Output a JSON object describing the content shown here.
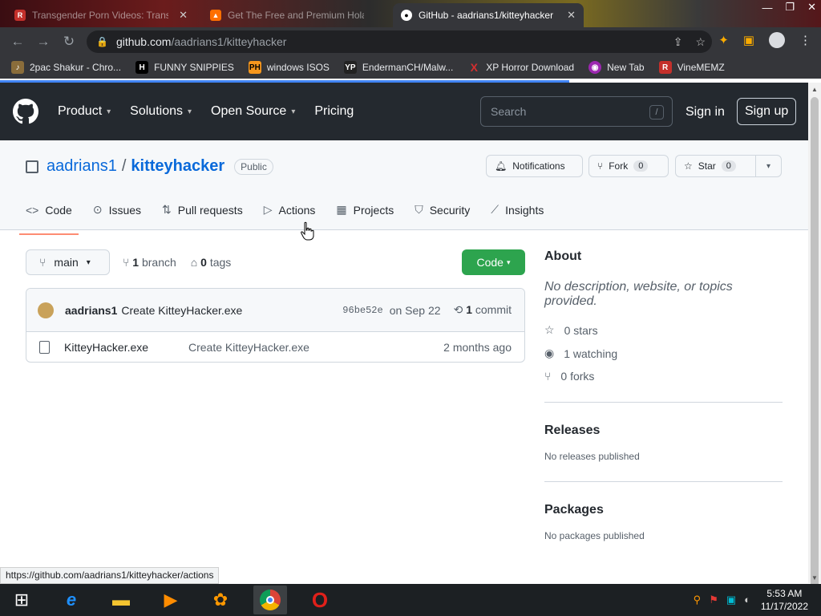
{
  "browser": {
    "tabs": [
      {
        "title": "Transgender Porn Videos: Trans...",
        "favicon": "R",
        "color": "#c4302b",
        "active": false
      },
      {
        "title": "Get The Free and Premium Hola ...",
        "favicon": "fire",
        "color": "#ff6f00",
        "active": false
      },
      {
        "title": "GitHub - aadrians1/kitteyhacker",
        "favicon": "github",
        "color": "#ffffff",
        "active": true
      }
    ],
    "url_host": "github.com",
    "url_path": "/aadrians1/kitteyhacker",
    "bookmarks": [
      {
        "label": "2pac Shakur - Chro...",
        "icon": "music-icon",
        "color": "#8a6d3b"
      },
      {
        "label": "FUNNY SNIPPIES",
        "icon": "H",
        "color": "#000000"
      },
      {
        "label": "windows ISOS",
        "icon": "PH",
        "color": "#f7971d"
      },
      {
        "label": "EndermanCH/Malw...",
        "icon": "YP",
        "color": "#222222"
      },
      {
        "label": "XP Horror Download",
        "icon": "X",
        "color": "#d32f2f"
      },
      {
        "label": "New Tab",
        "icon": "globe-icon",
        "color": "#9c27b0"
      },
      {
        "label": "VineMEMZ",
        "icon": "R",
        "color": "#c4302b"
      }
    ]
  },
  "github": {
    "nav": [
      "Product",
      "Solutions",
      "Open Source",
      "Pricing"
    ],
    "search_placeholder": "Search",
    "search_shortcut": "/",
    "sign_in": "Sign in",
    "sign_up": "Sign up"
  },
  "repo": {
    "owner": "aadrians1",
    "separator": "/",
    "name": "kitteyhacker",
    "visibility": "Public",
    "notifications": "Notifications",
    "fork_label": "Fork",
    "fork_count": "0",
    "star_label": "Star",
    "star_count": "0",
    "tabs": [
      "Code",
      "Issues",
      "Pull requests",
      "Actions",
      "Projects",
      "Security",
      "Insights"
    ],
    "branch": "main",
    "branch_count": "1",
    "branch_label": "branch",
    "tag_count": "0",
    "tag_label": "tags",
    "code_button": "Code",
    "commit": {
      "author": "aadrians1",
      "message": "Create KitteyHacker.exe",
      "sha": "96be52e",
      "date": "on Sep 22",
      "count": "1",
      "count_label": "commit"
    },
    "files": [
      {
        "name": "KitteyHacker.exe",
        "message": "Create KitteyHacker.exe",
        "age": "2 months ago"
      }
    ],
    "about": {
      "title": "About",
      "description": "No description, website, or topics provided.",
      "stars": "0 stars",
      "watching": "1 watching",
      "forks": "0 forks"
    },
    "releases": {
      "title": "Releases",
      "text": "No releases published"
    },
    "packages": {
      "title": "Packages",
      "text": "No packages published"
    }
  },
  "status_url": "https://github.com/aadrians1/kitteyhacker/actions",
  "taskbar": {
    "time": "5:53 AM",
    "date": "11/17/2022"
  }
}
